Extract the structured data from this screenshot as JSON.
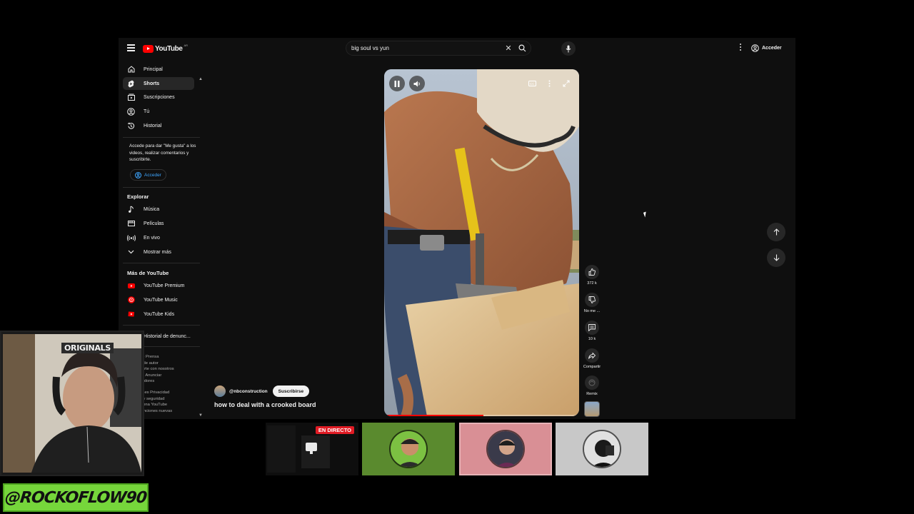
{
  "header": {
    "brand": "YouTube",
    "brand_suffix": "AR",
    "search_query": "big soul vs yun",
    "signin_label": "Acceder"
  },
  "sidebar": {
    "primary": [
      {
        "label": "Principal",
        "icon": "home-icon"
      },
      {
        "label": "Shorts",
        "icon": "shorts-icon",
        "active": true
      },
      {
        "label": "Suscripciones",
        "icon": "subscriptions-icon"
      },
      {
        "label": "Tú",
        "icon": "you-icon"
      },
      {
        "label": "Historial",
        "icon": "history-icon"
      }
    ],
    "login_prompt": "Accede para dar \"Me gusta\" a los videos, realizar comentarios y suscribirte.",
    "login_button": "Acceder",
    "explore_title": "Explorar",
    "explore": [
      {
        "label": "Música",
        "icon": "music-icon"
      },
      {
        "label": "Películas",
        "icon": "movies-icon"
      },
      {
        "label": "En vivo",
        "icon": "live-icon"
      },
      {
        "label": "Mostrar más",
        "icon": "chevron-down-icon"
      }
    ],
    "more_title": "Más de YouTube",
    "more": [
      {
        "label": "YouTube Premium",
        "icon": "youtube-premium-icon"
      },
      {
        "label": "YouTube Music",
        "icon": "youtube-music-icon"
      },
      {
        "label": "YouTube Kids",
        "icon": "youtube-kids-icon"
      }
    ],
    "report_history": "Historial de denunc...",
    "footer_lines_1": [
      "de  Prensa",
      "s de autor",
      "carte con nosotros",
      "es  Anunciar",
      "lladores"
    ],
    "footer_lines_2": [
      "ones  Privacidad",
      "s y seguridad",
      "ciona YouTube",
      "funciones nuevas"
    ]
  },
  "short": {
    "channel_handle": "@nbconstruction",
    "subscribe_label": "Suscribirse",
    "title": "how to deal with a crooked board",
    "progress": 0.51,
    "actions": {
      "likes": "372 k",
      "dislike": "No me ...",
      "comments": "10 k",
      "share": "Compartir",
      "remix": "Remix"
    }
  },
  "overlay": {
    "cam_sign": "ORIGINALS",
    "streamer_handle": "@ROCKOFLOW90",
    "live_badge": "EN DIRECTO",
    "tile_colors": [
      "#0e0e0e",
      "#5a8a2e",
      "#d98f95",
      "#c8c8c8"
    ]
  }
}
